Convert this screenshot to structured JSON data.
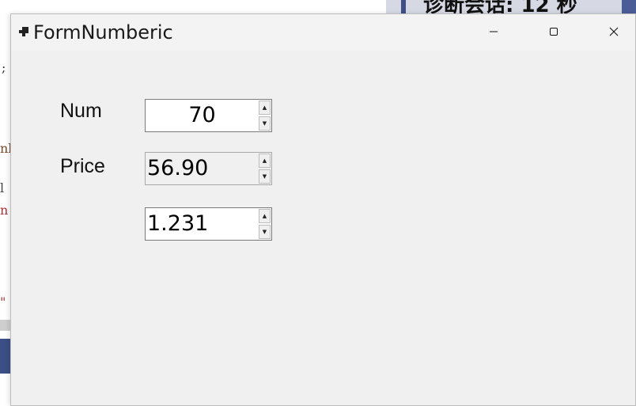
{
  "background": {
    "code_fragments": [
      ";",
      "nl",
      "l",
      "n",
      "\""
    ],
    "right_panel_text": "诊断会话: 12 秒"
  },
  "window": {
    "title": "FormNumberic",
    "controls": {
      "minimize_icon": "minimize-icon",
      "maximize_icon": "maximize-icon",
      "close_icon": "close-icon"
    }
  },
  "form": {
    "num": {
      "label": "Num",
      "value": "70",
      "align": "center"
    },
    "price": {
      "label": "Price",
      "value": "56.90",
      "align": "left",
      "enabled": false
    },
    "third": {
      "label": "",
      "value": "1.231",
      "align": "left"
    }
  },
  "colors": {
    "window_bg": "#f0f0f0",
    "input_bg": "#ffffff",
    "disabled_bg": "#f0f0f0"
  }
}
